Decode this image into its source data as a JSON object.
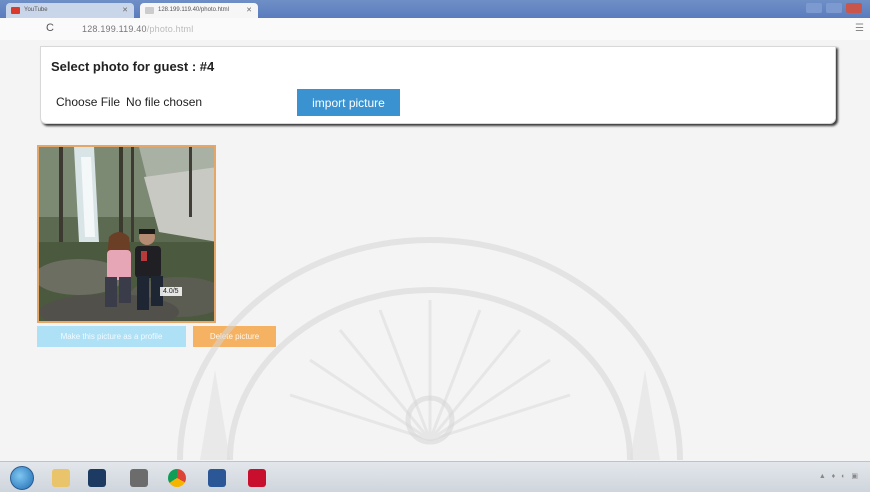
{
  "browser": {
    "tabs": [
      {
        "label": "YouTube",
        "favicon_color": "#d93a2b"
      },
      {
        "label": "128.199.119.40/photo.html",
        "favicon_color": "#cccccc"
      }
    ],
    "reload_icon": "reload-icon",
    "url": "128.199.119.40",
    "url_rest": "/photo.html"
  },
  "card": {
    "title": "Select photo for guest : #4",
    "choose_file_label": "Choose File",
    "no_file_text": "No file chosen",
    "import_button": "import picture"
  },
  "photo": {
    "size_label": "4.0/5",
    "make_profile_button": "Make this picture as a profile",
    "delete_button": "Delete picture"
  },
  "colors": {
    "import_button": "#3a93d0",
    "make_profile_button": "#aee0f6",
    "delete_button": "#f5b262",
    "photo_border": "#e5a768"
  },
  "taskbar": {
    "icons": [
      "windows-start-icon",
      "folder-icon",
      "photoshop-icon",
      "media-icon",
      "chrome-icon",
      "word-icon",
      "acrobat-icon"
    ]
  }
}
